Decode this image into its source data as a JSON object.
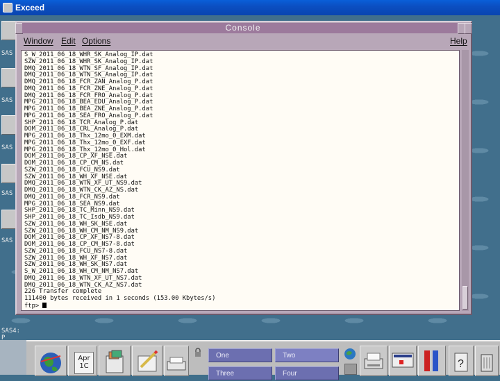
{
  "window": {
    "title": "Exceed"
  },
  "left_strip": {
    "labels": [
      "SAS",
      "SAS",
      "SAS",
      "SAS",
      "SAS",
      "SAS4: P"
    ]
  },
  "console": {
    "title": "Console",
    "menus": [
      "Window",
      "Edit",
      "Options"
    ],
    "help": "Help",
    "lines": [
      "S_W_2011_06_18_WHR_SK_Analog_IP.dat",
      "SZW_2011_06_18_WHR_SK_Analog_IP.dat",
      "DMQ_2011_06_18_WTN_SF_Analog_IP.dat",
      "DMQ_2011_06_18_WTN_SK_Analog_IP.dat",
      "DMQ_2011_06_18_FCR_ZAN_Analog_P.dat",
      "DMQ_2011_06_18_FCR_ZNE_Analog_P.dat",
      "DMQ_2011_06_18_FCR_FRO_Analog_P.dat",
      "MPG_2011_06_18_BEA_EDU_Analog_P.dat",
      "MPG_2011_06_18_BEA_ZNE_Analog_P.dat",
      "MPG_2011_06_18_SEA_FRO_Analog_P.dat",
      "SHP_2011_06_18_TCR_Analog_P.dat",
      "DOM_2011_06_18_CRL_Analog_P.dat",
      "MPG_2011_06_18_Thx_12mo_0_EXM.dat",
      "MPG_2011_06_18_Thx_12mo_0_EXF.dat",
      "MPG_2011_06_18_Thx_12mo_0_Hol.dat",
      "DOM_2011_06_18_CP_XF_NSE.dat",
      "DOM_2011_06_18_CP_CM_NS.dat",
      "SZW_2011_06_18_FCU_NS9.dat",
      "SZW_2011_06_18_WH_XF_NSE.dat",
      "DMQ_2011_06_18_WTN_XF_UT_NS9.dat",
      "DMQ_2011_06_18_WTN_CK_AZ_NS.dat",
      "DMQ_2011_06_18_FCR_NS9.dat",
      "MPG_2011_06_18_SEA_NS9.dat",
      "SHP_2011_06_18_TC_Minn_NS9.dat",
      "SHP_2011_06_18_TC_Isdb_NS9.dat",
      "SZW_2011_06_18_WH_SK_NSE.dat",
      "SZW_2011_06_18_WH_CM_NM_NS9.dat",
      "DOM_2011_06_18_CP_XF_NS7-8.dat",
      "DOM_2011_06_18_CP_CM_NS7-8.dat",
      "SZW_2011_06_18_FCU_NS7-8.dat",
      "SZW_2011_06_18_WH_XF_NS7.dat",
      "SZW_2011_06_18_WH_SK_NS7.dat",
      "S_W_2011_06_18_WH_CM_NM_NS7.dat",
      "DMQ_2011_06_18_WTN_XF_UT_NS7.dat",
      "DMQ_2011_06_18_WTN_CK_AZ_NS7.dat",
      "226 Transfer complete",
      "111400 bytes received in 1 seconds (153.00 Kbytes/s)"
    ],
    "prompt": "ftp> "
  },
  "front_panel": {
    "workspaces": [
      "One",
      "Two",
      "Three",
      "Four"
    ],
    "calendar": "Apr 1C"
  },
  "colors": {
    "titlebar": "#0b4fc2",
    "console_frame": "#b8a7b8",
    "console_title": "#9c7a9c",
    "workspace_button": "#6c6fb0",
    "desktop": "#416f8c"
  }
}
